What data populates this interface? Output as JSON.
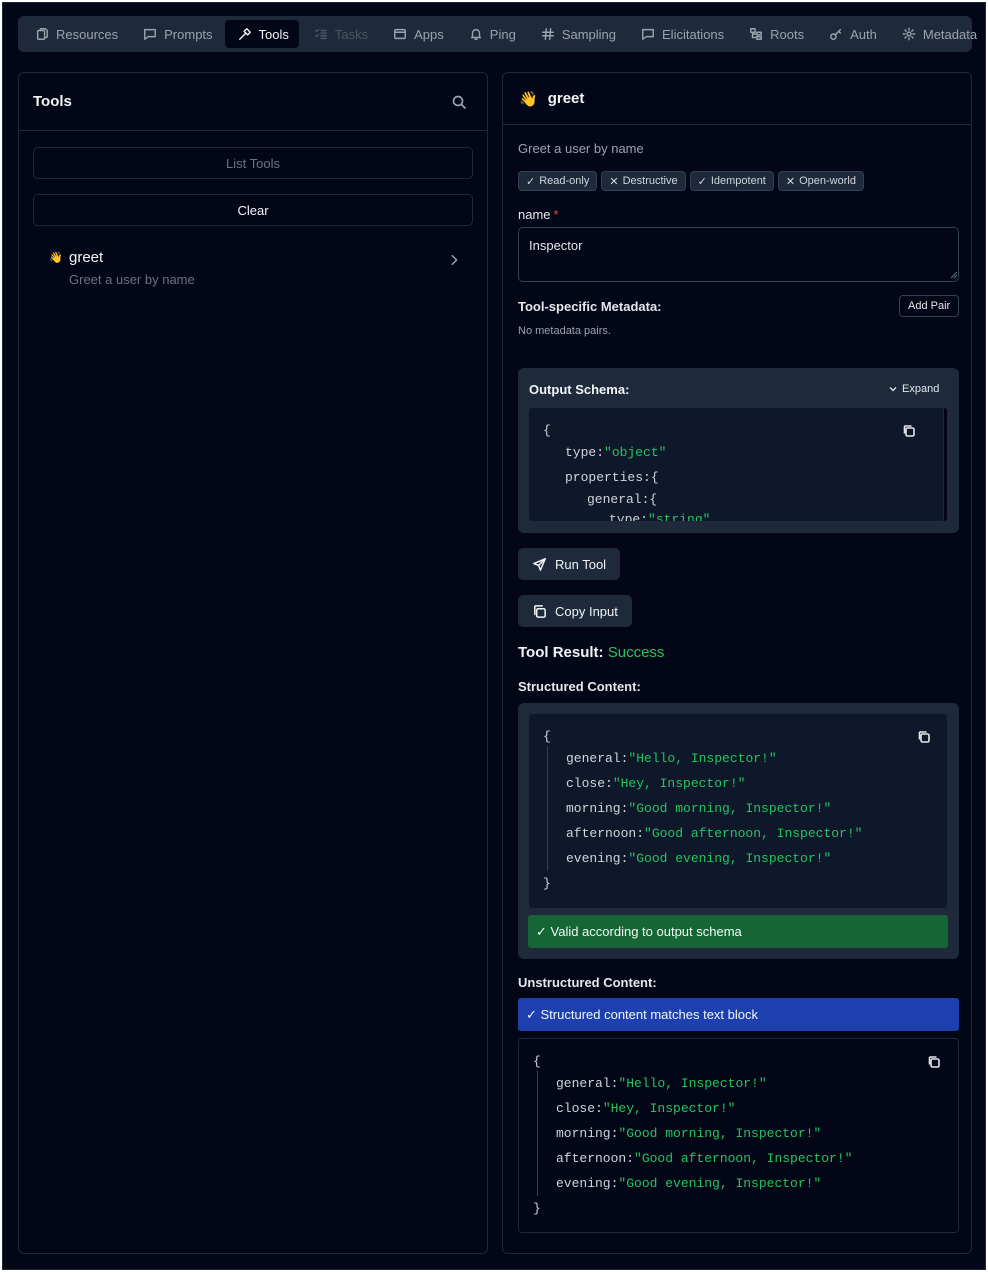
{
  "tabs": [
    {
      "label": "Resources",
      "icon": "files-icon",
      "state": "normal"
    },
    {
      "label": "Prompts",
      "icon": "message-icon",
      "state": "normal"
    },
    {
      "label": "Tools",
      "icon": "hammer-icon",
      "state": "active"
    },
    {
      "label": "Tasks",
      "icon": "list-checks-icon",
      "state": "disabled"
    },
    {
      "label": "Apps",
      "icon": "app-window-icon",
      "state": "normal"
    },
    {
      "label": "Ping",
      "icon": "bell-icon",
      "state": "normal"
    },
    {
      "label": "Sampling",
      "icon": "hash-icon",
      "state": "normal"
    },
    {
      "label": "Elicitations",
      "icon": "message-icon",
      "state": "normal"
    },
    {
      "label": "Roots",
      "icon": "folder-tree-icon",
      "state": "normal"
    },
    {
      "label": "Auth",
      "icon": "key-icon",
      "state": "normal"
    },
    {
      "label": "Metadata",
      "icon": "gear-icon",
      "state": "normal"
    }
  ],
  "tools_panel": {
    "title": "Tools",
    "list_button": "List Tools",
    "clear_button": "Clear",
    "items": [
      {
        "icon": "👋",
        "name": "greet",
        "description": "Greet a user by name"
      }
    ]
  },
  "detail": {
    "icon": "👋",
    "title": "greet",
    "description": "Greet a user by name",
    "annotations": [
      {
        "mark": "✓",
        "label": "Read-only"
      },
      {
        "mark": "✕",
        "label": "Destructive"
      },
      {
        "mark": "✓",
        "label": "Idempotent"
      },
      {
        "mark": "✕",
        "label": "Open-world"
      }
    ],
    "param_name": "name",
    "param_required_mark": "*",
    "param_value": "Inspector",
    "metadata_label": "Tool-specific Metadata:",
    "add_pair_label": "Add Pair",
    "no_metadata_text": "No metadata pairs.",
    "output_schema_label": "Output Schema:",
    "expand_label": "Expand",
    "schema_lines": [
      {
        "indent": 0,
        "key": "",
        "value": "{"
      },
      {
        "indent": 1,
        "key": "type:",
        "value": "\"object\""
      },
      {
        "indent": 1,
        "key": "properties:",
        "value": "{"
      },
      {
        "indent": 2,
        "key": "general:",
        "value": "{"
      },
      {
        "indent": 3,
        "key": "type:",
        "value": "\"string\""
      }
    ],
    "run_label": "Run Tool",
    "copy_input_label": "Copy Input",
    "result_label": "Tool Result:",
    "result_status": "Success",
    "structured_label": "Structured Content:",
    "structured_lines": [
      {
        "key": "general:",
        "value": "\"Hello, Inspector!\""
      },
      {
        "key": "close:",
        "value": "\"Hey, Inspector!\""
      },
      {
        "key": "morning:",
        "value": "\"Good morning, Inspector!\""
      },
      {
        "key": "afternoon:",
        "value": "\"Good afternoon, Inspector!\""
      },
      {
        "key": "evening:",
        "value": "\"Good evening, Inspector!\""
      }
    ],
    "open_brace": "{",
    "close_brace": "}",
    "valid_text": "✓ Valid according to output schema",
    "unstructured_label": "Unstructured Content:",
    "match_text": "✓ Structured content matches text block"
  },
  "colors": {
    "background": "#020617",
    "panel": "#1e293b",
    "string": "#22c55e",
    "success_banner": "#166534",
    "info_banner": "#1e40af",
    "required": "#ef4444"
  }
}
